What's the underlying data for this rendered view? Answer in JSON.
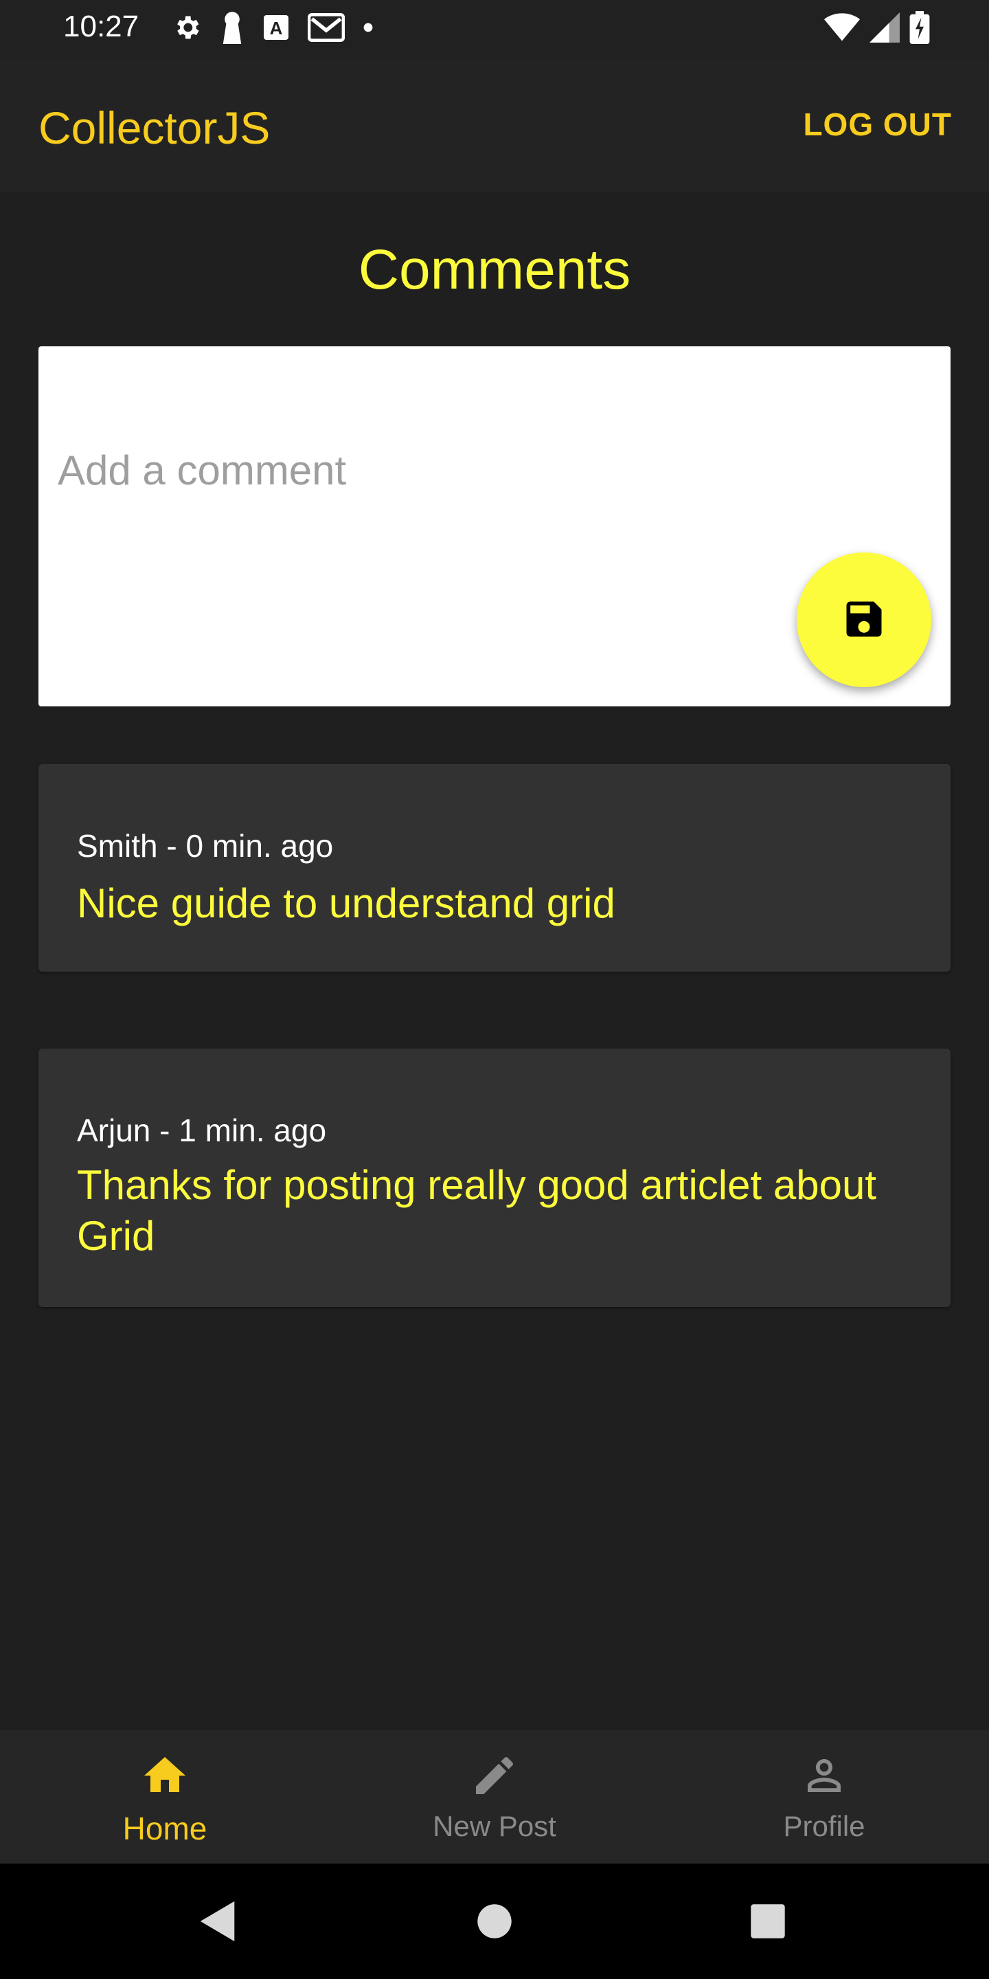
{
  "status_bar": {
    "time": "10:27",
    "left_icons": [
      "gear-icon",
      "keyhole-icon",
      "a-badge-icon",
      "gmail-icon",
      "dot-icon"
    ],
    "right_icons": [
      "wifi-icon",
      "signal-icon",
      "battery-charging-icon"
    ]
  },
  "app_bar": {
    "title": "CollectorJS",
    "logout_label": "LOG OUT"
  },
  "page": {
    "heading": "Comments"
  },
  "comment_form": {
    "placeholder": "Add a comment",
    "value": "",
    "save_icon": "floppy-disk-icon"
  },
  "comments": [
    {
      "meta": "Smith - 0 min. ago",
      "text": "Nice guide to understand grid"
    },
    {
      "meta": "Arjun - 1 min. ago",
      "text": "Thanks for posting really good articlet about Grid"
    }
  ],
  "bottom_nav": {
    "items": [
      {
        "label": "Home",
        "icon": "home-icon",
        "active": true
      },
      {
        "label": "New Post",
        "icon": "pencil-icon",
        "active": false
      },
      {
        "label": "Profile",
        "icon": "person-icon",
        "active": false
      }
    ]
  },
  "system_nav": [
    "back-icon",
    "home-circle-icon",
    "recents-icon"
  ],
  "colors": {
    "accent": "#f7cc1f",
    "highlight": "#fcfc3c",
    "background": "#1f1f1f",
    "card": "#333233"
  }
}
